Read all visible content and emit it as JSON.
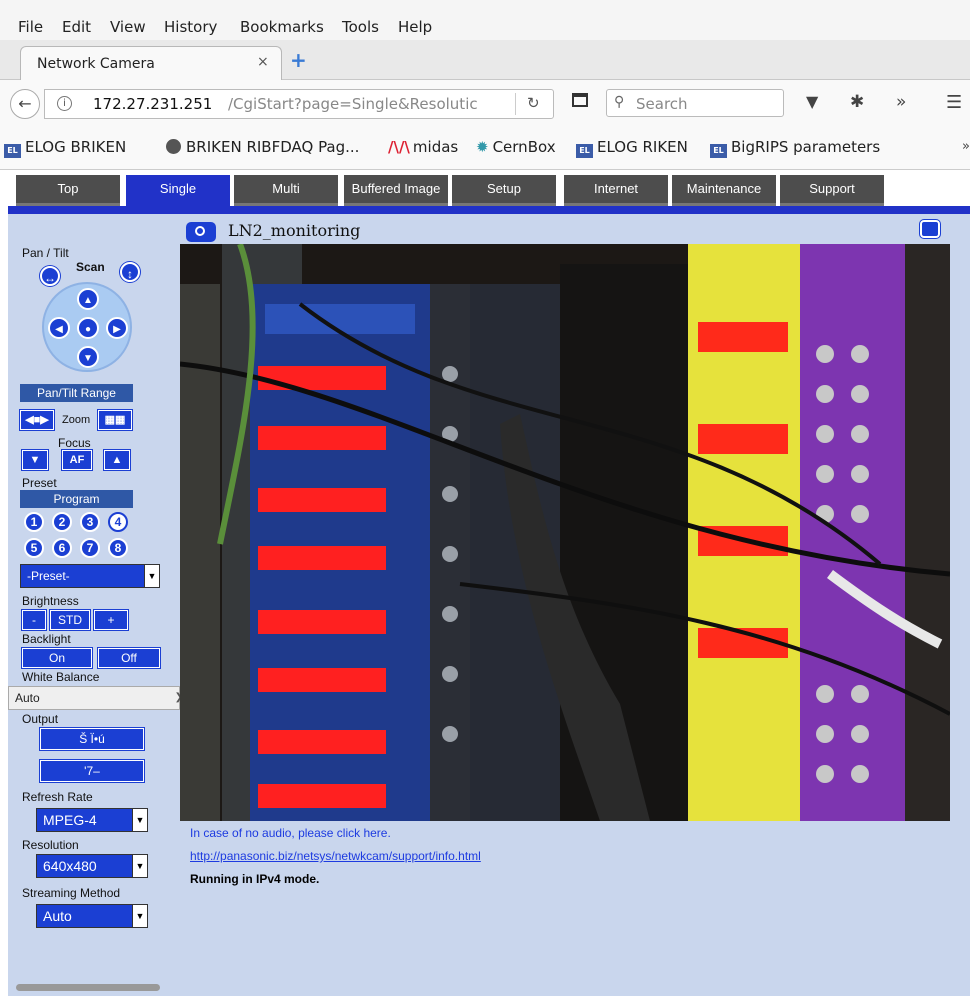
{
  "menu": [
    "File",
    "Edit",
    "View",
    "History",
    "Bookmarks",
    "Tools",
    "Help"
  ],
  "tab": {
    "title": "Network Camera",
    "close": "×",
    "new": "+"
  },
  "urlbar": {
    "host": "172.27.231.251",
    "path": "/CgiStart?page=Single&Resolutic"
  },
  "search": {
    "placeholder": "Search"
  },
  "bookmarks": [
    "ELOG BRIKEN",
    "BRIKEN RIBFDAQ Pag...",
    "midas",
    "CernBox",
    "ELOG RIKEN",
    "BigRIPS parameters"
  ],
  "bookmark_elog_badge": "EL",
  "nav_tabs": [
    "Top",
    "Single",
    "Multi",
    "Buffered Image",
    "Setup",
    "Internet",
    "Maintenance",
    "Support"
  ],
  "nav_active": "Single",
  "controls": {
    "pan_tilt_label": "Pan / Tilt",
    "scan_label": "Scan",
    "pan_tilt_range": "Pan/Tilt Range",
    "zoom_label": "Zoom",
    "focus_label": "Focus",
    "af_label": "AF",
    "preset_label": "Preset",
    "program_label": "Program",
    "preset_numbers": [
      "1",
      "2",
      "3",
      "4",
      "5",
      "6",
      "7",
      "8"
    ],
    "preset_select": "-Preset-",
    "brightness_label": "Brightness",
    "brightness_minus": "-",
    "brightness_std": "STD",
    "brightness_plus": "+",
    "backlight_label": "Backlight",
    "backlight_on": "On",
    "backlight_off": "Off",
    "white_balance_label": "White Balance",
    "white_balance_value": "Auto",
    "output_label": "Output",
    "output_btn_1": "Š Ï•ú",
    "output_btn_2": "'7–",
    "refresh_rate_label": "Refresh Rate",
    "refresh_rate_value": "MPEG-4",
    "resolution_label": "Resolution",
    "resolution_value": "640x480",
    "streaming_label": "Streaming Method",
    "streaming_value": "Auto"
  },
  "camera": {
    "title": "LN2_monitoring"
  },
  "links": {
    "audio": "In case of no audio, please click here.",
    "support": "http://panasonic.biz/netsys/netwkcam/support/info.html",
    "status": "Running in IPv4 mode."
  }
}
